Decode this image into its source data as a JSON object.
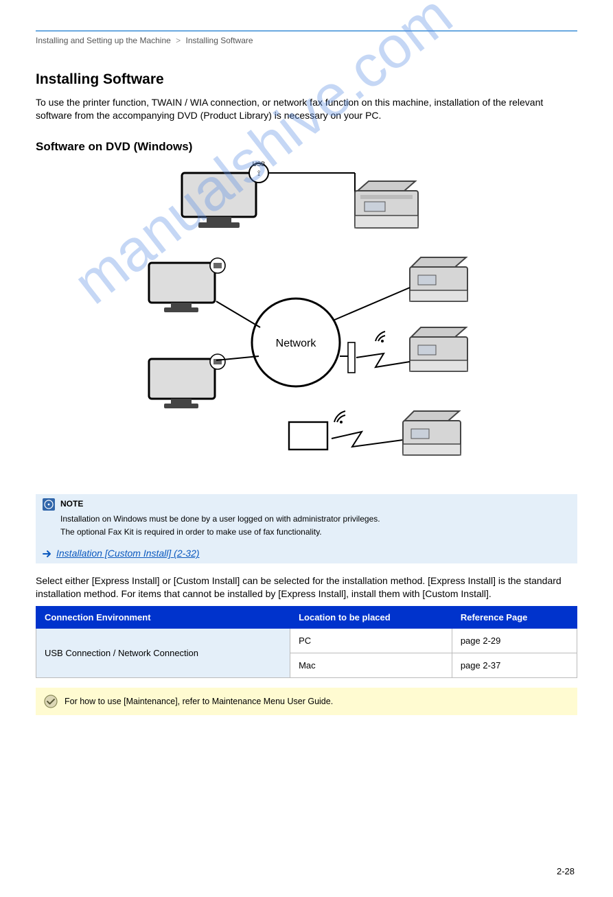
{
  "breadcrumbs": [
    "Installing and Setting up the Machine",
    "Installing Software"
  ],
  "h2": "Installing Software",
  "intro": "To use the printer function, TWAIN / WIA connection, or network fax function on this machine, installation of the relevant software from the accompanying DVD (Product Library) is necessary on your PC.",
  "h3a": "Software on DVD (Windows)",
  "h3b": "Select either [Express Install] or [Custom Install] can be selected for the installation method. [Express Install] is the standard installation method. For items that cannot be installed by [Express Install], install them with [Custom Install].",
  "diagrams": {
    "usb_label": "USB",
    "network_label": "Network"
  },
  "note": {
    "text1": "Installation on Windows must be done by a user logged on with administrator privileges.",
    "text2": "The optional Fax Kit is required in order to make use of fax functionality."
  },
  "link": {
    "text": "Installation [Custom Install] (2-32)"
  },
  "table": {
    "headers": [
      "Connection Environment",
      "Location to be placed",
      "Reference Page"
    ],
    "rows": [
      {
        "env": "USB Connection / Network Connection",
        "loc": "PC",
        "ref": "page 2-29"
      },
      {
        "env": "",
        "loc": "Mac",
        "ref": "page 2-37"
      }
    ]
  },
  "tip": "For how to use [Maintenance], refer to Maintenance Menu User Guide.",
  "pagenum": "2-28",
  "watermark": "manualshive.com"
}
